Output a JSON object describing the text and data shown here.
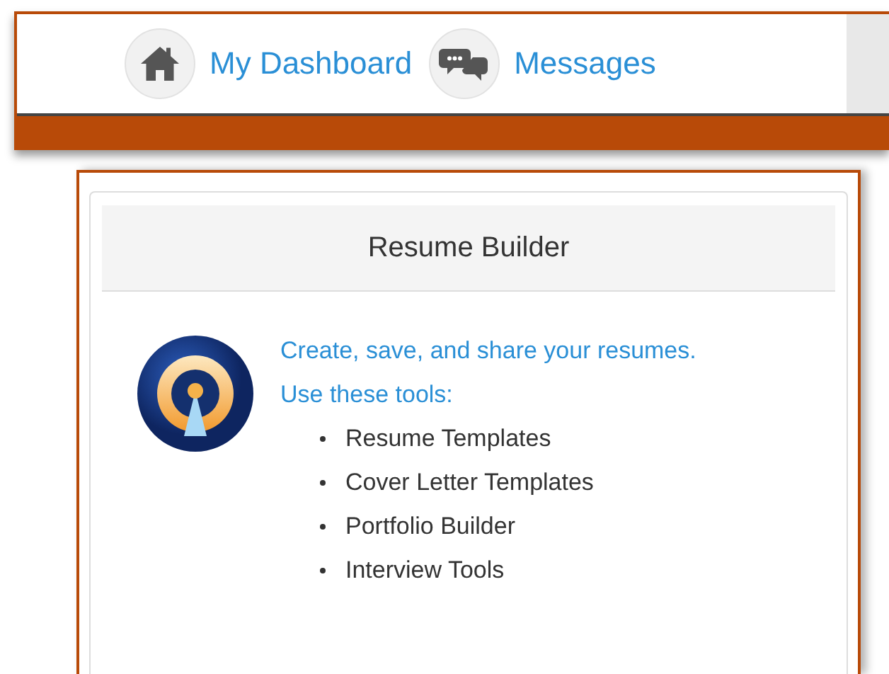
{
  "nav": {
    "links": [
      {
        "kind": "home",
        "label": "My Dashboard"
      },
      {
        "kind": "messages",
        "label": "Messages"
      }
    ]
  },
  "card": {
    "title": "Resume Builder",
    "intro": [
      "Create, save, and share your resumes.",
      "Use these tools:"
    ],
    "tools": [
      "Resume Templates",
      "Cover Letter Templates",
      "Portfolio Builder",
      "Interview Tools"
    ]
  }
}
